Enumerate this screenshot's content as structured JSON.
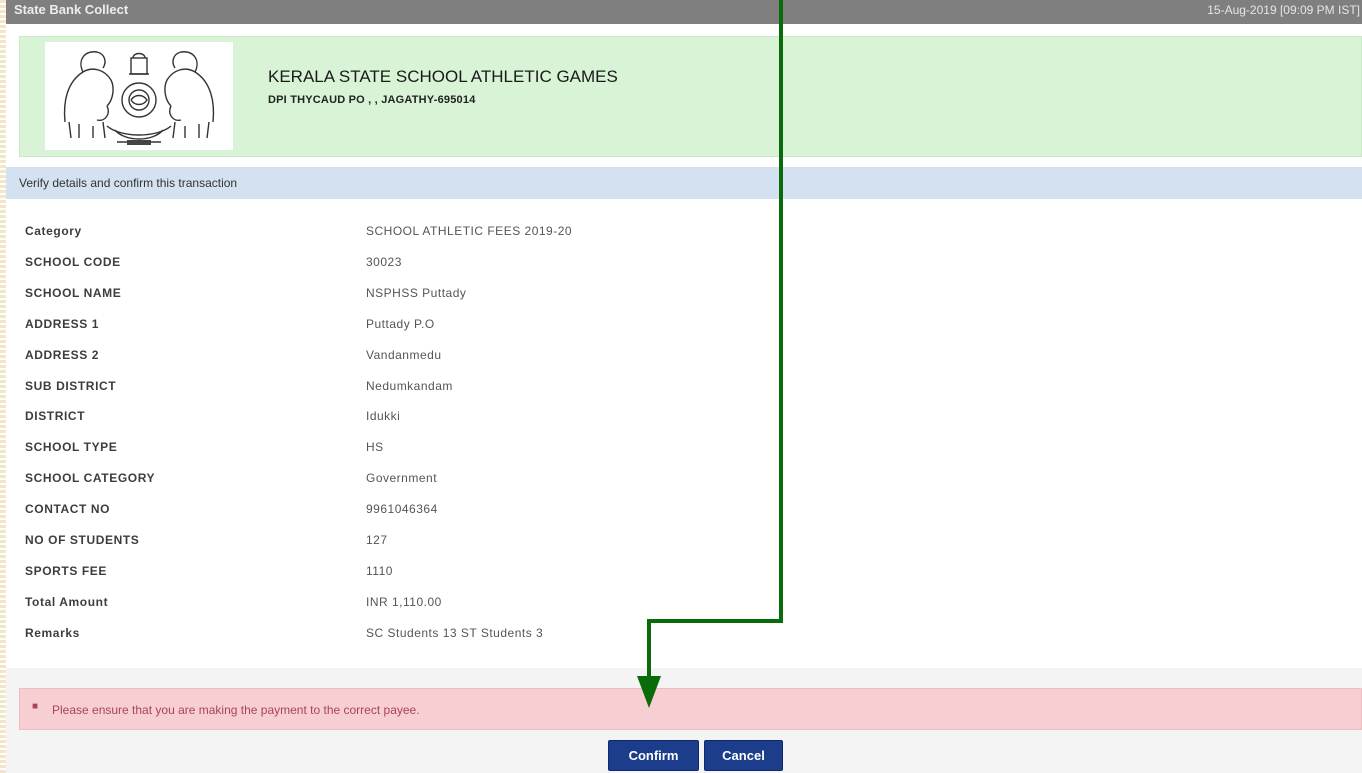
{
  "topbar": {
    "app_title": "State Bank Collect",
    "timestamp": "15-Aug-2019 [09:09 PM IST]"
  },
  "header": {
    "org_name": "KERALA STATE SCHOOL ATHLETIC GAMES",
    "org_address": "DPI THYCAUD PO , , JAGATHY-695014",
    "logo": "kerala-emblem-icon"
  },
  "verify_text": "Verify details and confirm this transaction",
  "details": [
    {
      "label": "Category",
      "value": "SCHOOL ATHLETIC FEES 2019-20"
    },
    {
      "label": "SCHOOL CODE",
      "value": "30023"
    },
    {
      "label": "SCHOOL NAME",
      "value": "NSPHSS Puttady"
    },
    {
      "label": "ADDRESS 1",
      "value": "Puttady P.O"
    },
    {
      "label": "ADDRESS 2",
      "value": "Vandanmedu"
    },
    {
      "label": "SUB DISTRICT",
      "value": "Nedumkandam"
    },
    {
      "label": "DISTRICT",
      "value": "Idukki"
    },
    {
      "label": "SCHOOL TYPE",
      "value": "HS"
    },
    {
      "label": "SCHOOL CATEGORY",
      "value": "Government"
    },
    {
      "label": "CONTACT NO",
      "value": "9961046364"
    },
    {
      "label": "NO OF STUDENTS",
      "value": "127"
    },
    {
      "label": "SPORTS FEE",
      "value": "1110"
    },
    {
      "label": "Total Amount",
      "value": "INR 1,110.00"
    },
    {
      "label": "Remarks",
      "value": "SC Students 13 ST Students 3"
    }
  ],
  "alert": {
    "message": "Please ensure that you are making the payment to the correct payee."
  },
  "buttons": {
    "confirm": "Confirm",
    "cancel": "Cancel"
  },
  "colors": {
    "topbar": "#7f7f7f",
    "header_bg": "#d8f3d6",
    "verify_bg": "#d4e1f1",
    "alert_bg": "#f7cfd3",
    "button": "#1b3d8c",
    "annotation_arrow": "#0a6b0a"
  },
  "annotation": {
    "type": "arrow",
    "points_to": "confirm-button"
  }
}
